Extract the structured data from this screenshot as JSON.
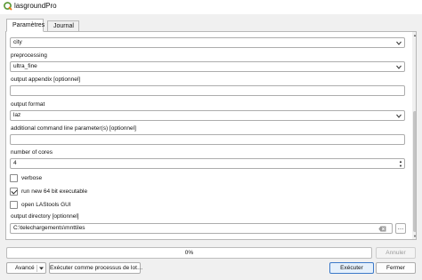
{
  "window": {
    "title": "lasgroundPro",
    "icon": "qgis-logo-icon"
  },
  "tabs": [
    {
      "label": "Paramètres",
      "active": true
    },
    {
      "label": "Journal",
      "active": false
    }
  ],
  "params": {
    "first_combo_value": "city",
    "preprocessing": {
      "label": "preprocessing",
      "value": "ultra_fine"
    },
    "output_appendix": {
      "label": "output appendix [optionnel]",
      "value": ""
    },
    "output_format": {
      "label": "output format",
      "value": "laz"
    },
    "additional_cmd": {
      "label": "additional command line parameter(s) [optionnel]",
      "value": ""
    },
    "number_of_cores": {
      "label": "number of cores",
      "value": "4"
    },
    "verbose": {
      "label": "verbose",
      "checked": false
    },
    "run_64bit": {
      "label": "run new 64 bit executable",
      "checked": true
    },
    "open_gui": {
      "label": "open LAStools GUI",
      "checked": false
    },
    "output_directory": {
      "label": "output directory [optionnel]",
      "value": "C:\\telechargements\\mnttiles",
      "browse_label": "…"
    }
  },
  "footer": {
    "progress_text": "0%",
    "progress_fraction": 0,
    "cancel_label": "Annuler",
    "advanced_label": "Avancé",
    "batch_label": "Exécuter comme processus de lot…",
    "run_label": "Exécuter",
    "close_label": "Fermer"
  },
  "colors": {
    "primary_button_border": "#3b79c9",
    "qgis_green": "#589632",
    "qgis_yellow": "#ee7913"
  }
}
